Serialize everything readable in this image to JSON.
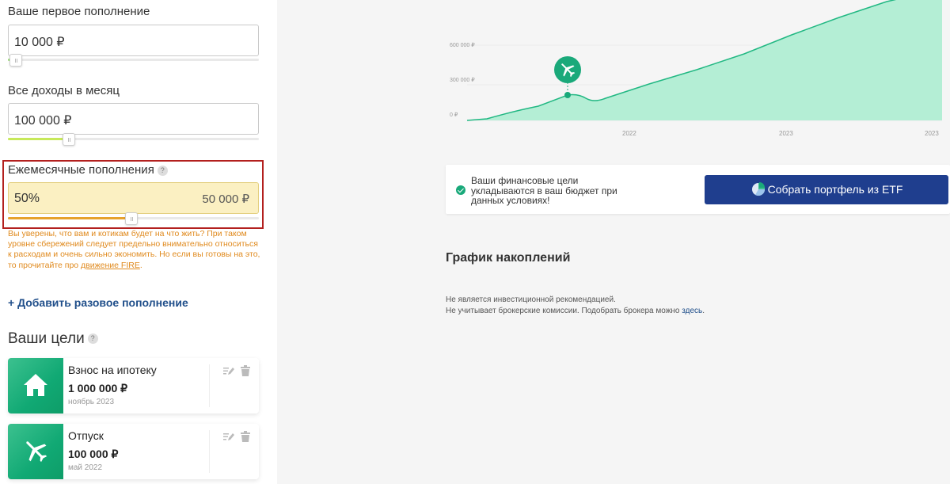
{
  "left": {
    "first_deposit": {
      "label": "Ваше первое пополнение",
      "value": "10 000 ₽",
      "slider_fraction": 0.03
    },
    "income": {
      "label": "Все доходы в месяц",
      "value": "100 000 ₽",
      "slider_fraction": 0.24
    },
    "monthly": {
      "label": "Ежемесячные пополнения",
      "help": "?",
      "percent": "50%",
      "amount": "50 000 ₽",
      "slider_fraction": 0.49
    },
    "warning": {
      "text": "Вы уверены, что вам и котикам будет на что жить? При таком уровне сбережений следует предельно внимательно относиться к расходам и очень сильно экономить. Но если вы готовы на это, то прочитайте про ",
      "link": "движение FIRE",
      "tail": "."
    },
    "add_link": "+ Добавить разовое пополнение",
    "goals_title": "Ваши цели",
    "goals_help": "?",
    "goals": [
      {
        "name": "Взнос на ипотеку",
        "amount": "1 000 000 ₽",
        "date": "ноябрь 2023",
        "icon": "house-icon"
      },
      {
        "name": "Отпуск",
        "amount": "100 000 ₽",
        "date": "май 2022",
        "icon": "airplane-icon"
      }
    ]
  },
  "chart_data": {
    "type": "area",
    "y_ticks": [
      "600 000 ₽",
      "300 000 ₽",
      "0 ₽"
    ],
    "x_ticks": [
      "2022",
      "2023",
      "2023"
    ],
    "ylim": [
      0,
      1000000
    ],
    "marker": {
      "icon": "airplane-icon",
      "note": "goal marker"
    },
    "color": "#b4eed5",
    "line_color": "#22b883"
  },
  "info": {
    "text": "Ваши финансовые цели укладываются в ваш бюджет при данных условиях!",
    "button": "Собрать портфель из ETF"
  },
  "section_title": "График накоплений",
  "disclaimer": {
    "line1": "Не является инвестиционной рекомендацией.",
    "line2": "Не учитывает брокерские комиссии. Подобрать брокера можно ",
    "link": "здесь",
    "tail": "."
  }
}
